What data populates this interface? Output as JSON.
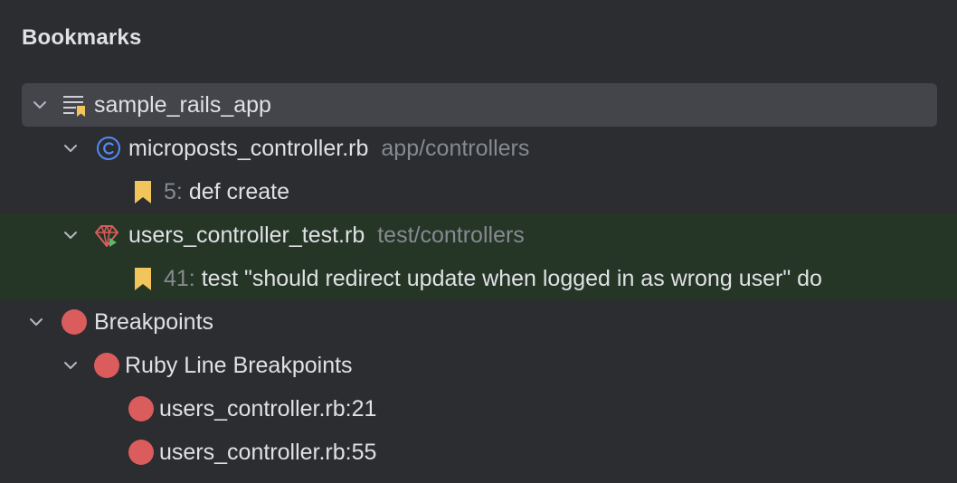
{
  "panel": {
    "title": "Bookmarks"
  },
  "tree": {
    "project": {
      "label": "sample_rails_app",
      "icon": "bookmark-list-icon"
    },
    "file1": {
      "name": "microposts_controller.rb",
      "path": "app/controllers",
      "icon": "ruby-class-icon"
    },
    "bookmark1": {
      "line": "5:",
      "text": "def create",
      "icon": "bookmark-icon"
    },
    "file2": {
      "name": "users_controller_test.rb",
      "path": "test/controllers",
      "icon": "ruby-test-icon"
    },
    "bookmark2": {
      "line": "41:",
      "text": "test \"should redirect update when logged in as wrong user\" do",
      "icon": "bookmark-icon"
    },
    "breakpoints": {
      "label": "Breakpoints",
      "icon": "breakpoint-icon"
    },
    "ruby_line": {
      "label": "Ruby Line Breakpoints",
      "icon": "breakpoint-icon"
    },
    "bp1": {
      "label": "users_controller.rb:21"
    },
    "bp2": {
      "label": "users_controller.rb:55"
    }
  },
  "colors": {
    "background": "#2b2d30",
    "selection": "#43454a",
    "highlight_row": "#253526",
    "breakpoint": "#db5c5c",
    "bookmark": "#f2c55c",
    "class_icon": "#548af7"
  }
}
